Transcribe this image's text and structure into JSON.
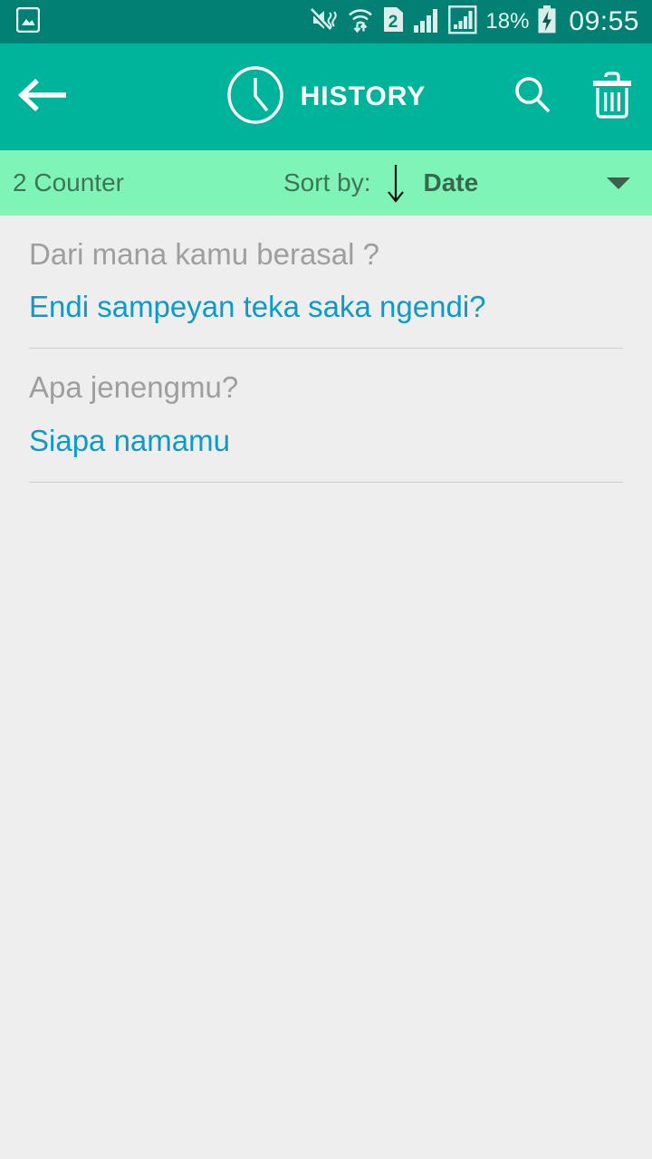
{
  "statusbar": {
    "left_icons": [
      "photo-icon"
    ],
    "right_icons": [
      "mute-vibrate-icon",
      "wifi-icon",
      "sim2-icon",
      "signal-bars-icon",
      "signal-boxed-icon"
    ],
    "battery_percent": "18%",
    "battery_state": "charging",
    "clock": "09:55"
  },
  "appbar": {
    "back_icon": "arrow-left-icon",
    "clock_icon": "clock-icon",
    "title": "HISTORY",
    "search_icon": "search-icon",
    "delete_icon": "trash-icon",
    "background": "#00b49c"
  },
  "sortbar": {
    "counter": "2 Counter",
    "sort_label": "Sort by:",
    "sort_direction_icon": "arrow-down-icon",
    "sort_value": "Date",
    "dropdown_icon": "chevron-down-icon",
    "background": "#7ef5b7"
  },
  "list": {
    "items": [
      {
        "question": "Dari mana kamu berasal ?",
        "answer": "Endi sampeyan teka saka ngendi?"
      },
      {
        "question": "Apa jenengmu?",
        "answer": "Siapa namamu"
      }
    ]
  },
  "colors": {
    "statusbar_bg": "#028074",
    "appbar_bg": "#00b49c",
    "sortbar_bg": "#7ef5b7",
    "body_bg": "#efeeee",
    "question_text": "#9e9e9e",
    "answer_text": "#0d9ac9",
    "divider": "#cfcfcf"
  }
}
